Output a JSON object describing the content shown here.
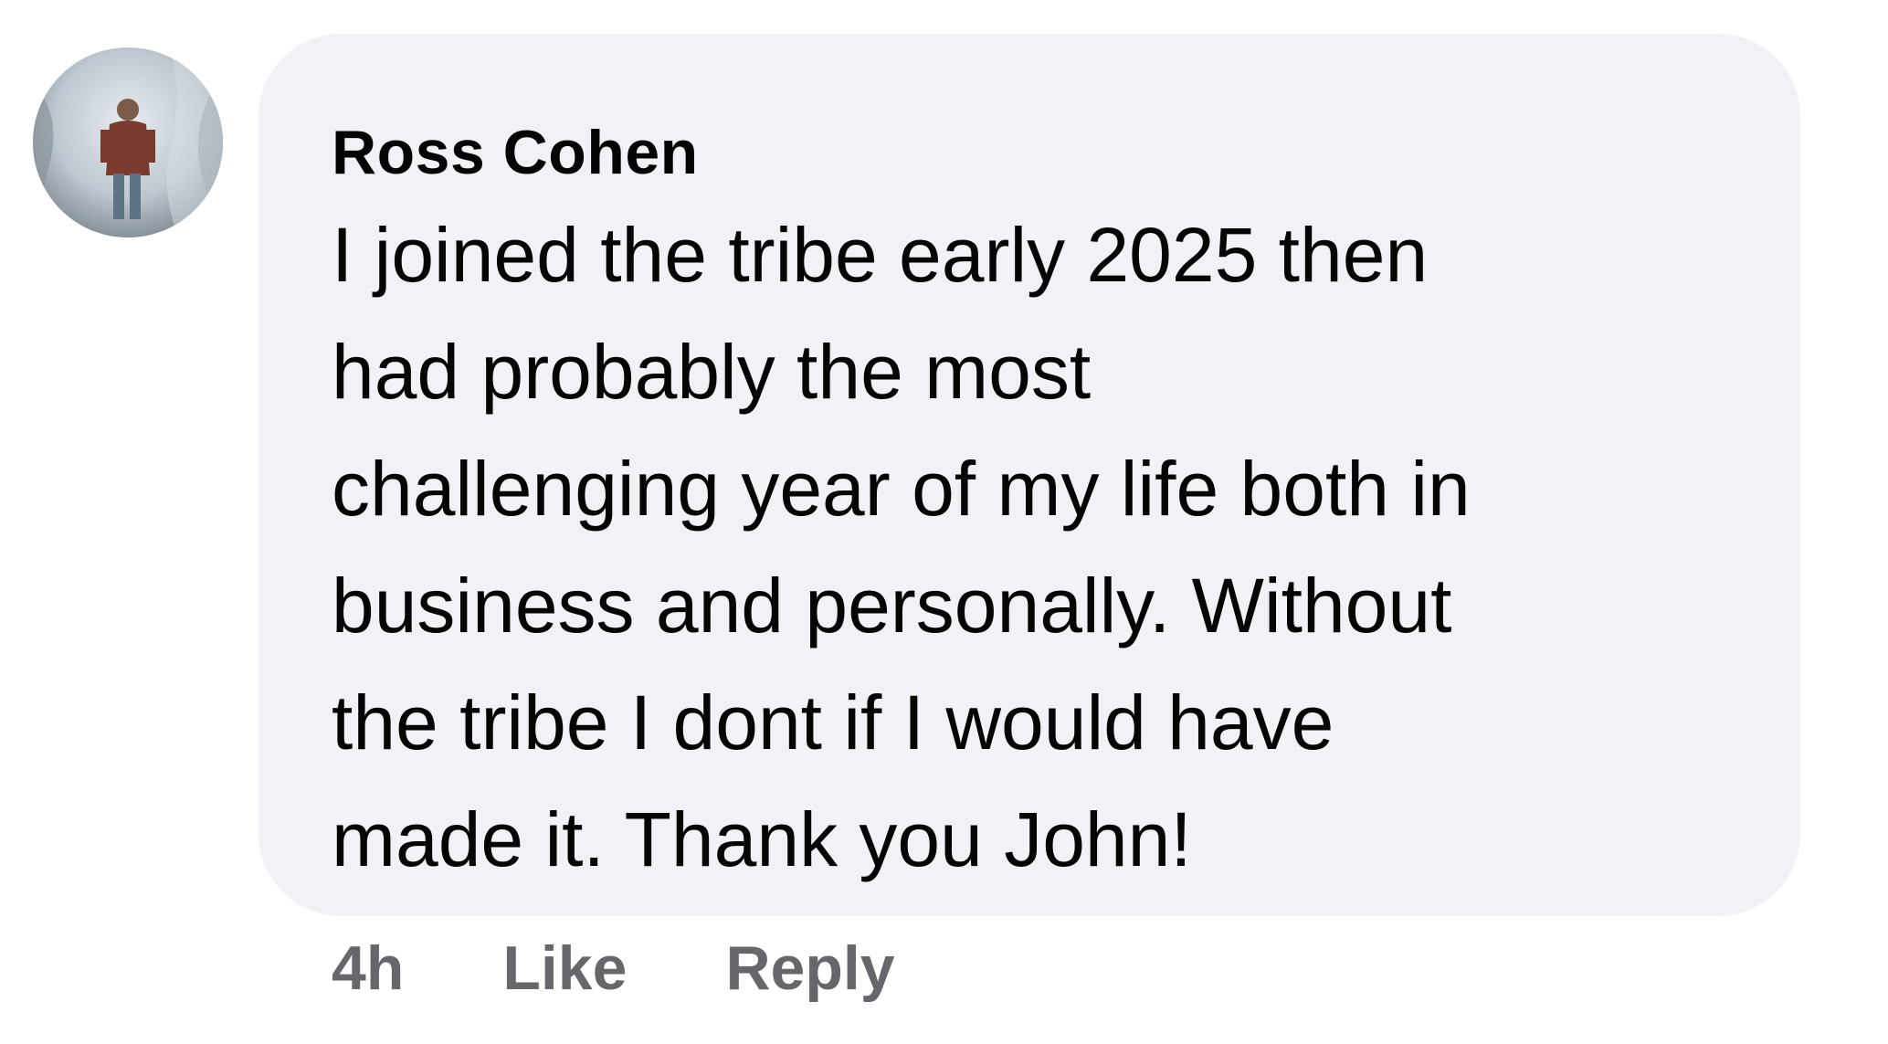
{
  "comment": {
    "author": "Ross Cohen",
    "text_lines": [
      "I joined the tribe early 2025 then",
      "had probably the most",
      "challenging year of my life both in",
      "business and personally. Without",
      "the tribe I dont if I would have",
      "made it. Thank you John!"
    ],
    "timestamp": "4h",
    "like_label": "Like",
    "reply_label": "Reply"
  },
  "colors": {
    "bubble_background": "#f0f2f5",
    "text": "#050505",
    "secondary_text": "#65676b"
  },
  "icons": {
    "avatar": "profile-photo"
  }
}
